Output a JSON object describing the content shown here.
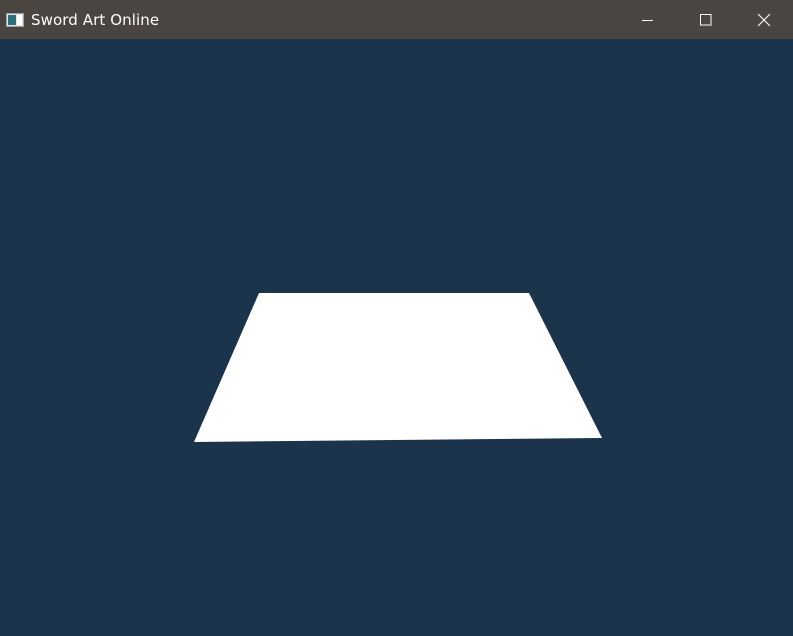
{
  "window": {
    "title": "Sword Art Online",
    "app_icon": "app-window-icon",
    "controls": {
      "minimize_icon": "minimize-icon",
      "maximize_icon": "maximize-icon",
      "close_icon": "close-icon"
    }
  },
  "scene": {
    "background_color": "#1b334b",
    "plane_color": "#ffffff",
    "titlebar_color": "#4a4541"
  }
}
